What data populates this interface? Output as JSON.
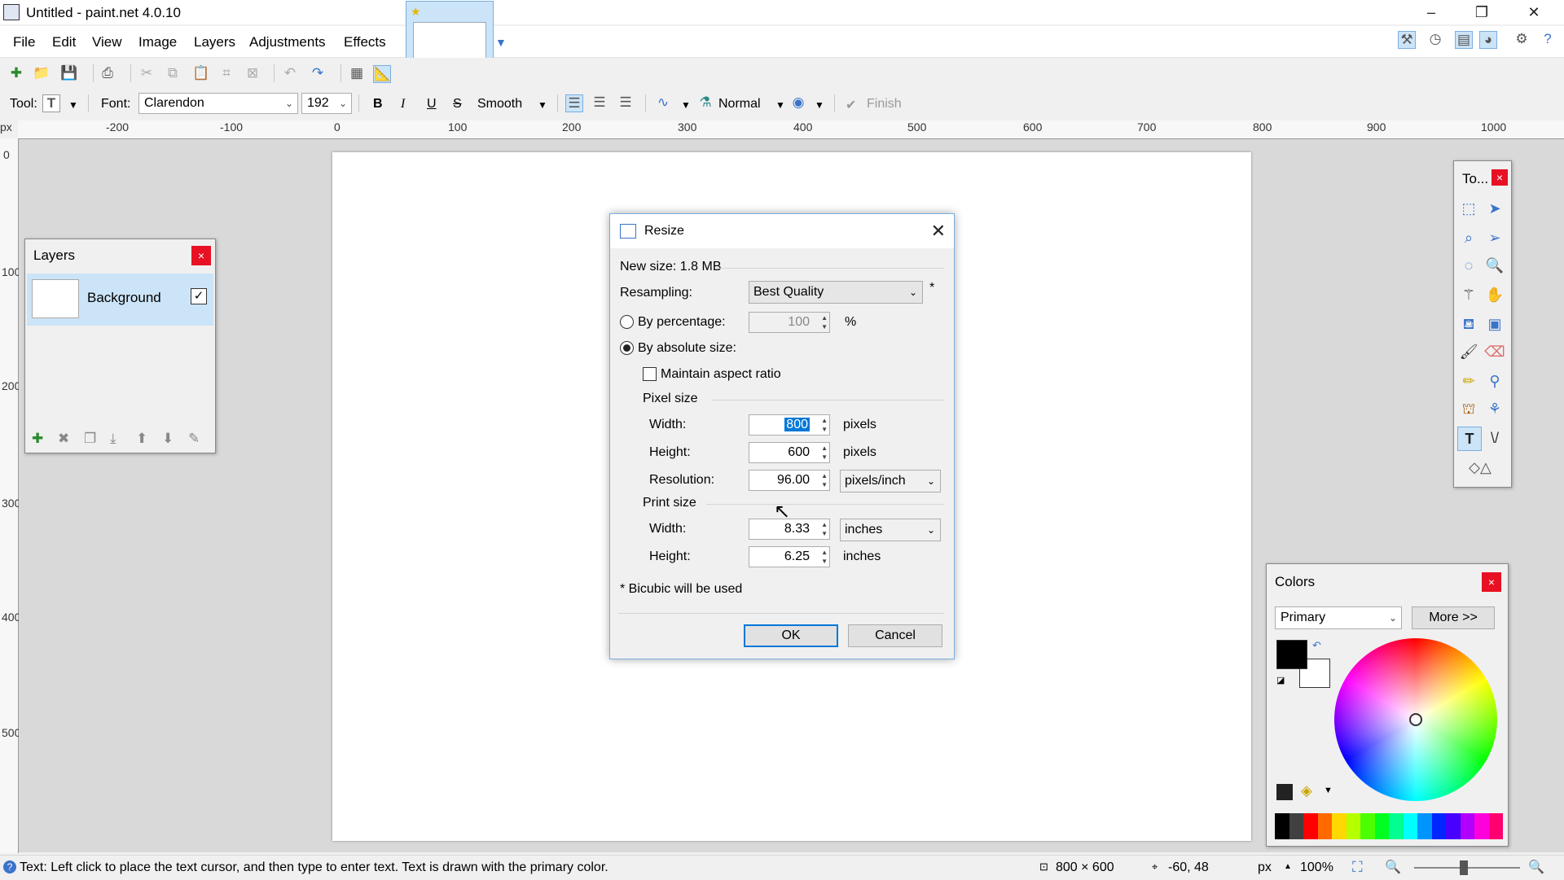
{
  "window": {
    "title": "Untitled - paint.net 4.0.10",
    "minimize": "–",
    "restore": "❐",
    "close": "✕"
  },
  "menu": [
    "File",
    "Edit",
    "View",
    "Image",
    "Layers",
    "Adjustments",
    "Effects"
  ],
  "tool_options": {
    "tool_label": "Tool:",
    "font_label": "Font:",
    "font_value": "Clarendon",
    "size_value": "192",
    "antialias": "Smooth",
    "blend_mode": "Normal",
    "finish": "Finish",
    "bold": "B",
    "italic": "I",
    "underline": "U",
    "strike": "S"
  },
  "ruler": {
    "unit": "px",
    "top_labels": [
      "-200",
      "-100",
      "0",
      "100",
      "200",
      "300",
      "400",
      "500",
      "600",
      "700",
      "800",
      "900",
      "1000"
    ],
    "left_labels": [
      "0",
      "100",
      "200",
      "300",
      "400",
      "500"
    ]
  },
  "layers_panel": {
    "title": "Layers",
    "layer_name": "Background",
    "visible_check": "✓"
  },
  "tools_panel": {
    "title": "To..."
  },
  "colors_panel": {
    "title": "Colors",
    "mode": "Primary",
    "more": "More >>",
    "primary_color": "#000000",
    "secondary_color": "#ffffff",
    "palette": [
      "#000000",
      "#404040",
      "#ff0000",
      "#ff6a00",
      "#ffd800",
      "#b6ff00",
      "#4cff00",
      "#00ff21",
      "#00ff90",
      "#00ffff",
      "#0094ff",
      "#0026ff",
      "#4800ff",
      "#b200ff",
      "#ff00dc",
      "#ff006e"
    ]
  },
  "dialog": {
    "title": "Resize",
    "new_size": "New size: 1.8 MB",
    "resampling_label": "Resampling:",
    "resampling_value": "Best Quality",
    "asterisk": "*",
    "by_percentage": "By percentage:",
    "percentage_value": "100",
    "percent_sign": "%",
    "by_absolute": "By absolute size:",
    "maintain_aspect": "Maintain aspect ratio",
    "pixel_size": "Pixel size",
    "width_label": "Width:",
    "height_label": "Height:",
    "resolution_label": "Resolution:",
    "pixel_width": "800",
    "pixel_height": "600",
    "resolution": "96.00",
    "pixels_unit": "pixels",
    "resolution_unit": "pixels/inch",
    "print_size": "Print size",
    "print_width": "8.33",
    "print_height": "6.25",
    "inches_unit": "inches",
    "note": "* Bicubic will be used",
    "ok": "OK",
    "cancel": "Cancel"
  },
  "status": {
    "hint": "Text: Left click to place the text cursor, and then type to enter text. Text is drawn with the primary color.",
    "image_size": "800 × 600",
    "cursor_pos": "-60, 48",
    "unit": "px",
    "zoom": "100%"
  }
}
